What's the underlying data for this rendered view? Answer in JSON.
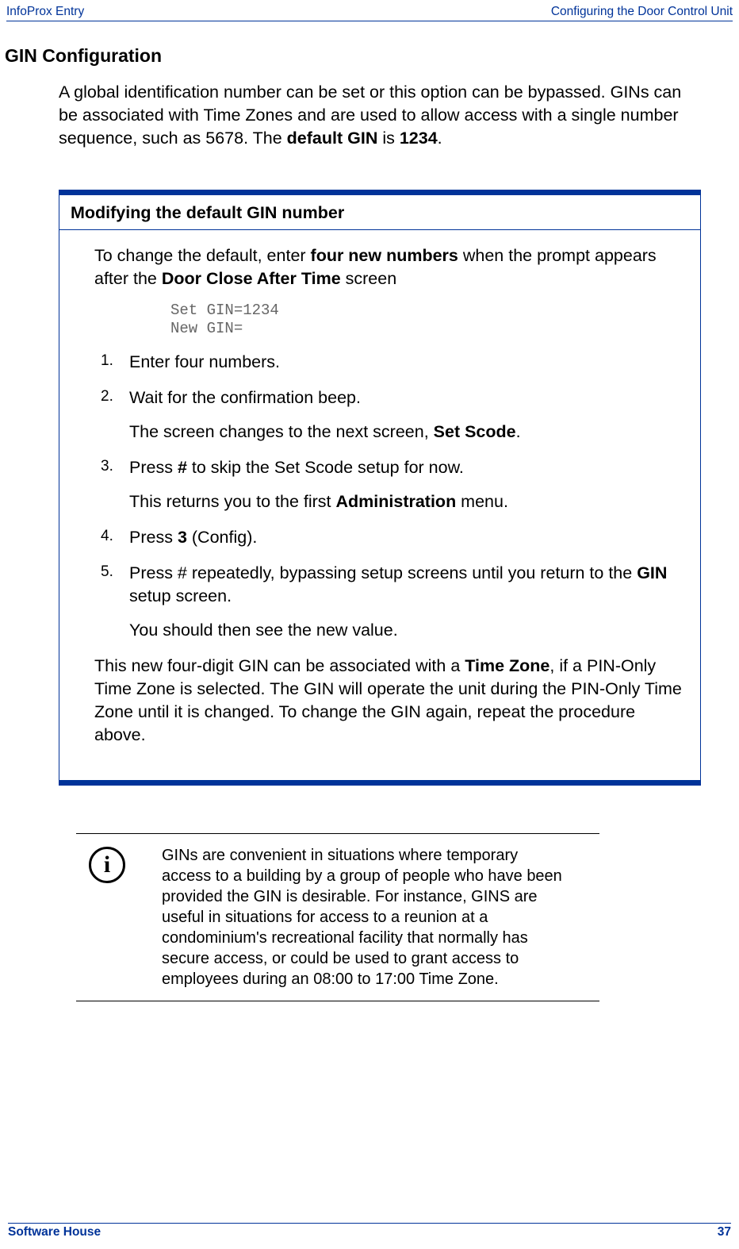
{
  "header": {
    "left": "InfoProx Entry",
    "right": "Configuring the Door Control Unit"
  },
  "title": "GIN Configuration",
  "intro_html": "A global identification number can be set or this option can be bypassed. GINs can be associated with Time Zones and are used to allow access with a single number sequence, such as 5678. The <b>default GIN</b> is <b>1234</b>.",
  "box": {
    "title": "Modifying the default GIN number",
    "lead_html": "To change the default, enter <b>four new numbers</b> when the prompt appears after the <b>Door Close After Time</b> screen",
    "code": "Set GIN=1234\nNew GIN=",
    "steps": [
      {
        "n": "1.",
        "paras": [
          "Enter four numbers."
        ]
      },
      {
        "n": "2.",
        "paras": [
          "Wait for the confirmation beep.",
          "The screen changes to the next screen, <b>Set Scode</b>."
        ]
      },
      {
        "n": "3.",
        "paras": [
          "Press <b>#</b> to skip the Set Scode setup for now.",
          "This returns you to the first <b>Administration</b> menu."
        ]
      },
      {
        "n": "4.",
        "paras": [
          "Press <b>3</b> (Config)."
        ]
      },
      {
        "n": "5.",
        "paras": [
          "Press # repeatedly, bypassing setup screens until you return to the <b>GIN</b> setup screen.",
          "You should then see the new value."
        ]
      }
    ],
    "closing_html": "This new four-digit GIN can be associated with a <b>Time Zone</b>, if a PIN-Only Time Zone is selected. The GIN will operate the unit during the PIN-Only Time Zone until it is changed. To change the GIN again, repeat the procedure above."
  },
  "info": {
    "icon_glyph": "i",
    "text": "GINs are convenient in situations where temporary access to a building by a group of people who have been provided the GIN is desirable. For instance, GINS are useful in situations for access to a reunion at a condominium's recreational facility that normally has secure access, or could be used to grant access to employees during an 08:00 to 17:00 Time Zone."
  },
  "footer": {
    "left": "Software House",
    "right": "37"
  }
}
